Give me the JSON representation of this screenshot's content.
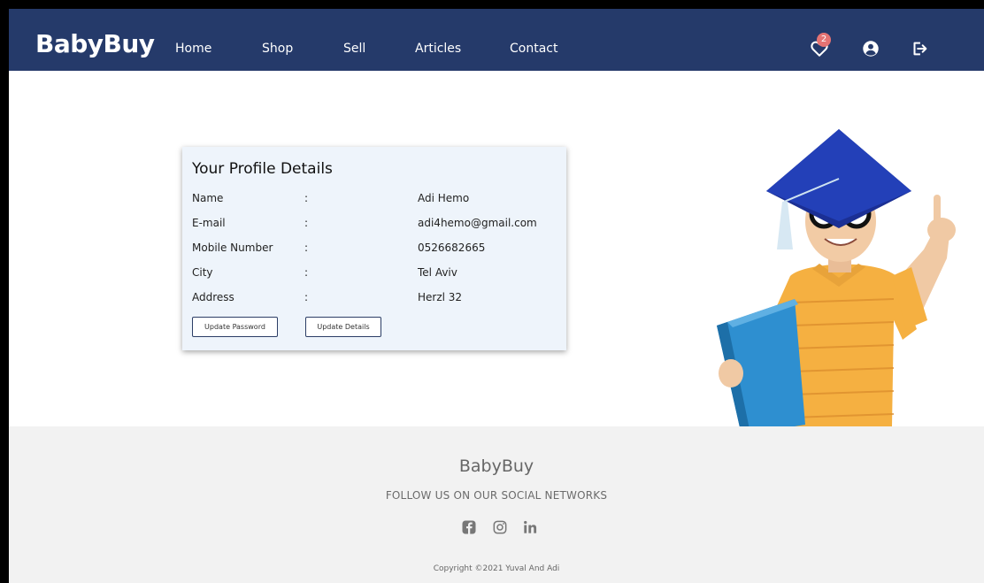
{
  "navbar": {
    "brand": "BabyBuy",
    "links": [
      "Home",
      "Shop",
      "Sell",
      "Articles",
      "Contact"
    ],
    "wishlist_count": "2",
    "icons": [
      "heart-icon",
      "user-icon",
      "logout-icon"
    ]
  },
  "profile": {
    "title": "Your Profile Details",
    "separator": ":",
    "rows": [
      {
        "label": "Name",
        "value": "Adi Hemo"
      },
      {
        "label": "E-mail",
        "value": "adi4hemo@gmail.com"
      },
      {
        "label": "Mobile Number",
        "value": "0526682665"
      },
      {
        "label": "City",
        "value": "Tel Aviv"
      },
      {
        "label": "Address",
        "value": "Herzl 32"
      }
    ],
    "update_password_label": "Update Password",
    "update_details_label": "Update Details"
  },
  "footer": {
    "brand": "BabyBuy",
    "follow": "FOLLOW US ON OUR SOCIAL NETWORKS",
    "social_icons": [
      "facebook-icon",
      "instagram-icon",
      "linkedin-icon"
    ],
    "copyright": "Copyright ©2021 Yuval And Adi"
  },
  "colors": {
    "navbar": "#253a6a",
    "card": "#eef4fb",
    "footer": "#f2f2f2",
    "badge": "#e57373",
    "shirt": "#f5b041",
    "cap": "#1f3fae",
    "book": "#2e8fd0"
  }
}
